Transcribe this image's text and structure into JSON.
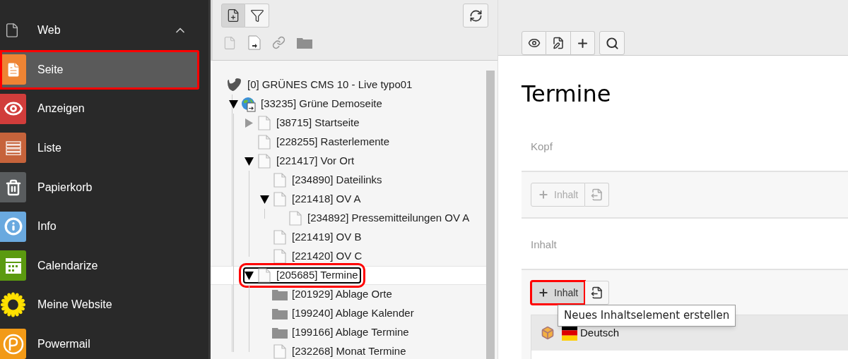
{
  "sidebar": {
    "group": {
      "label": "Web",
      "expanded": true
    },
    "items": [
      {
        "label": "Seite",
        "selected": true,
        "annotated": true,
        "color": "#ee8434"
      },
      {
        "label": "Anzeigen",
        "selected": false,
        "annotated": false,
        "color": "#d13d3b"
      },
      {
        "label": "Liste",
        "selected": false,
        "annotated": false,
        "color": "#c6633b"
      },
      {
        "label": "Papierkorb",
        "selected": false,
        "annotated": false,
        "color": "#595c5e"
      },
      {
        "label": "Info",
        "selected": false,
        "annotated": false,
        "color": "#6aa9df"
      },
      {
        "label": "Calendarize",
        "selected": false,
        "annotated": false,
        "color": "#5b9a10"
      },
      {
        "label": "Meine Website",
        "selected": false,
        "annotated": false
      },
      {
        "label": "Powermail",
        "selected": false,
        "annotated": false,
        "color": "#f29a17"
      }
    ]
  },
  "tree_tools": [
    {
      "selected": true
    },
    {
      "selected": false
    }
  ],
  "tree": [
    {
      "label": "[0] GRÜNES CMS 10 - Live typo01",
      "kind": "root",
      "selected": false,
      "children": [
        {
          "label": "[33235] Grüne Demoseite",
          "kind": "site",
          "selected": false,
          "expanded": true,
          "children": [
            {
              "label": "[38715] Startseite",
              "kind": "page",
              "selected": false,
              "expanded": false
            },
            {
              "label": "[228255] Rasterlemente",
              "kind": "page",
              "selected": false
            },
            {
              "label": "[221417] Vor Ort",
              "kind": "page",
              "selected": false,
              "expanded": true,
              "children": [
                {
                  "label": "[234890] Dateilinks",
                  "kind": "page",
                  "selected": false
                },
                {
                  "label": "[221418] OV A",
                  "kind": "page",
                  "selected": false,
                  "expanded": true,
                  "children": [
                    {
                      "label": "[234892] Pressemitteilungen OV A",
                      "kind": "page",
                      "selected": false
                    }
                  ]
                },
                {
                  "label": "[221419] OV B",
                  "kind": "page",
                  "selected": false
                },
                {
                  "label": "[221420] OV C",
                  "kind": "page",
                  "selected": false
                }
              ]
            },
            {
              "label": "[205685] Termine",
              "kind": "page",
              "selected": true,
              "annotated": true,
              "expanded": true,
              "children": [
                {
                  "label": "[201929] Ablage Orte",
                  "kind": "folder",
                  "selected": false
                },
                {
                  "label": "[199240] Ablage Kalender",
                  "kind": "folder",
                  "selected": false
                },
                {
                  "label": "[199166] Ablage Termine",
                  "kind": "folder",
                  "selected": false
                },
                {
                  "label": "[232268] Monat Termine",
                  "kind": "page",
                  "selected": false
                }
              ]
            }
          ]
        }
      ]
    }
  ],
  "page_title": "Termine",
  "sections": [
    {
      "label": "Kopf",
      "button_label": "Inhalt",
      "disabled": true,
      "hovered": false,
      "annotated": false
    },
    {
      "label": "Inhalt",
      "button_label": "Inhalt",
      "disabled": false,
      "hovered": true,
      "annotated": true,
      "tooltip": "Neues Inhaltselement erstellen",
      "language": "Deutsch"
    }
  ]
}
